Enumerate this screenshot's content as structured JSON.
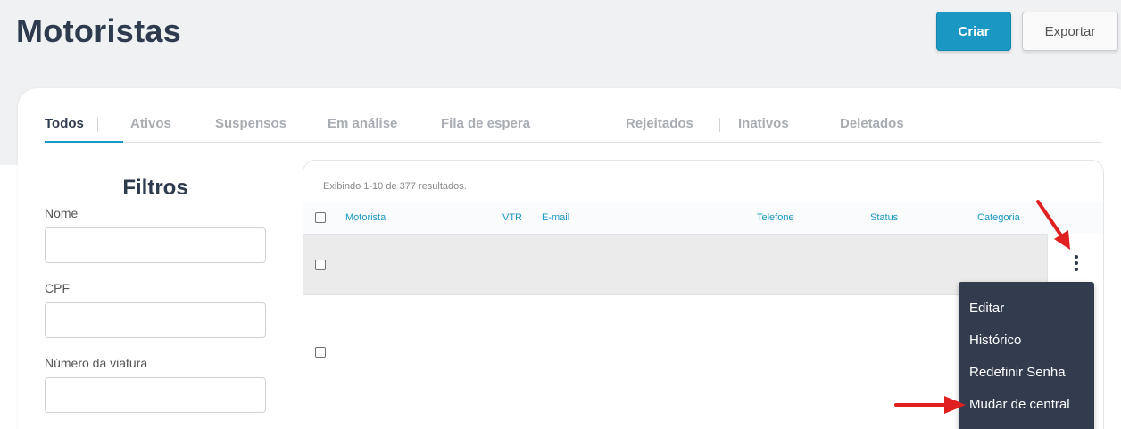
{
  "page": {
    "title": "Motoristas"
  },
  "toolbar": {
    "create_label": "Criar",
    "export_label": "Exportar"
  },
  "tabs": [
    {
      "label": "Todos"
    },
    {
      "label": "Ativos"
    },
    {
      "label": "Suspensos"
    },
    {
      "label": "Em análise"
    },
    {
      "label": "Fila de espera"
    },
    {
      "label": "Rejeitados"
    },
    {
      "label": "Inativos"
    },
    {
      "label": "Deletados"
    }
  ],
  "filters": {
    "title": "Filtros",
    "fields": [
      {
        "label": "Nome",
        "value": ""
      },
      {
        "label": "CPF",
        "value": ""
      },
      {
        "label": "Número da viatura",
        "value": ""
      }
    ]
  },
  "table": {
    "results_text": "Exibindo 1-10 de 377 resultados.",
    "columns": [
      "Motorista",
      "VTR",
      "E-mail",
      "Telefone",
      "Status",
      "Categoria"
    ]
  },
  "row_menu": {
    "items": [
      "Editar",
      "Histórico",
      "Redefinir Senha",
      "Mudar de central"
    ]
  },
  "colors": {
    "accent": "#1a97c3",
    "title": "#2e3a4e",
    "menu_bg": "#323c4e",
    "annotation_arrow": "#e02020"
  }
}
